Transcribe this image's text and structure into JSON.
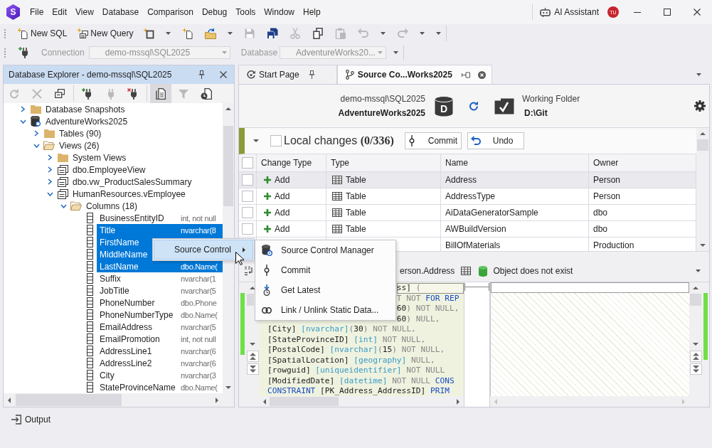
{
  "title_bar": {
    "logo": "S",
    "menu": [
      "File",
      "Edit",
      "View",
      "Database",
      "Comparison",
      "Debug",
      "Tools",
      "Window",
      "Help"
    ],
    "ai_assistant": "AI Assistant",
    "avatar": "TU"
  },
  "toolbar": {
    "buttons": [
      {
        "label": "New SQL"
      },
      {
        "label": "New Query"
      }
    ],
    "tools": [
      {
        "disabled": false,
        "dropdown": true
      },
      {
        "disabled": false,
        "dropdown": false
      },
      {
        "disabled": false,
        "dropdown": true
      },
      {
        "disabled": true,
        "dropdown": false
      },
      {
        "disabled": false,
        "dropdown": false
      },
      {
        "disabled": true,
        "dropdown": false
      },
      {
        "disabled": false,
        "dropdown": false
      },
      {
        "disabled": true,
        "dropdown": false
      },
      {
        "disabled": true,
        "dropdown": true
      },
      {
        "disabled": true,
        "dropdown": true
      }
    ]
  },
  "connection_bar": {
    "fields": [
      {
        "label": "Connection",
        "value": "demo-mssql\\SQL2025",
        "disabled": true
      },
      {
        "label": "Database",
        "value": "AdventureWorks20...",
        "disabled": true
      }
    ]
  },
  "explorer": {
    "title": "Database Explorer - demo-mssql\\SQL2025",
    "tools": [
      {
        "disabled": true,
        "selected": false
      },
      {
        "disabled": true,
        "selected": false
      },
      {
        "disabled": false,
        "selected": false
      },
      {
        "disabled": false,
        "selected": false
      },
      {
        "disabled": true,
        "selected": false
      },
      {
        "disabled": false,
        "selected": false
      },
      {
        "disabled": false,
        "selected": true
      },
      {
        "disabled": true,
        "selected": false
      },
      {
        "disabled": false,
        "selected": false
      }
    ],
    "tree": [
      {
        "label": "Database Snapshots",
        "kind": "folder",
        "expanded": false,
        "selected": false
      },
      {
        "label": "AdventureWorks2025",
        "kind": "database",
        "expanded": true,
        "selected": false,
        "children": [
          {
            "label": "Tables (90)",
            "kind": "folder",
            "expanded": false,
            "selected": false
          },
          {
            "label": "Views (26)",
            "kind": "folder",
            "expanded": true,
            "selected": false,
            "children": [
              {
                "label": "System Views",
                "kind": "folder",
                "expanded": false,
                "selected": false
              },
              {
                "label": "dbo.EmployeeView",
                "kind": "view",
                "expanded": false,
                "selected": false
              },
              {
                "label": "dbo.vw_ProductSalesSummary",
                "kind": "view",
                "expanded": false,
                "selected": false
              },
              {
                "label": "HumanResources.vEmployee",
                "kind": "view",
                "expanded": true,
                "selected": false,
                "children": [
                  {
                    "label": "Columns (18)",
                    "kind": "folder",
                    "expanded": true,
                    "selected": false,
                    "children": [
                      {
                        "label": "BusinessEntityID",
                        "kind": "column",
                        "detail": "int, not null",
                        "selected": false
                      },
                      {
                        "label": "Title",
                        "kind": "column",
                        "detail": "nvarchar(8",
                        "selected": true
                      },
                      {
                        "label": "FirstName",
                        "kind": "column",
                        "selected": true
                      },
                      {
                        "label": "MiddleName",
                        "kind": "column",
                        "selected": true
                      },
                      {
                        "label": "LastName",
                        "kind": "column",
                        "detail": "dbo.Name(",
                        "selected": true
                      },
                      {
                        "label": "Suffix",
                        "kind": "column",
                        "detail": "nvarchar(1",
                        "selected": false
                      },
                      {
                        "label": "JobTitle",
                        "kind": "column",
                        "detail": "nvarchar(5",
                        "selected": false
                      },
                      {
                        "label": "PhoneNumber",
                        "kind": "column",
                        "detail": "dbo.Phone",
                        "selected": false
                      },
                      {
                        "label": "PhoneNumberType",
                        "kind": "column",
                        "detail": "dbo.Name(",
                        "selected": false
                      },
                      {
                        "label": "EmailAddress",
                        "kind": "column",
                        "detail": "nvarchar(5",
                        "selected": false
                      },
                      {
                        "label": "EmailPromotion",
                        "kind": "column",
                        "detail": "int, not null",
                        "selected": false
                      },
                      {
                        "label": "AddressLine1",
                        "kind": "column",
                        "detail": "nvarchar(6",
                        "selected": false
                      },
                      {
                        "label": "AddressLine2",
                        "kind": "column",
                        "detail": "nvarchar(6",
                        "selected": false
                      },
                      {
                        "label": "City",
                        "kind": "column",
                        "detail": "nvarchar(3",
                        "selected": false
                      },
                      {
                        "label": "StateProvinceName",
                        "kind": "column",
                        "detail": "dbo.Name(",
                        "selected": false
                      }
                    ]
                  }
                ]
              }
            ]
          }
        ]
      }
    ]
  },
  "tabs": [
    {
      "label": "Start Page",
      "selected": false,
      "pinned": true
    },
    {
      "label": "Source Co...Works2025",
      "selected": true,
      "pinned": false
    }
  ],
  "source_control": {
    "server": "demo-mssql\\SQL2025",
    "database": "AdventureWorks2025",
    "database_badge": "D",
    "folder_label": "Working Folder",
    "folder": "D:\\Git",
    "local_changes": {
      "expanded": true,
      "checked": false,
      "title": "Local changes **(0/336)**",
      "buttons": [
        {
          "label": "Commit"
        },
        {
          "label": "Undo"
        }
      ]
    },
    "table": {
      "all_checked": false,
      "columns": [
        "Change Type",
        "Type",
        "Name",
        "Owner"
      ],
      "rows": [
        {
          "checked": false,
          "selected": true,
          "change_type": "Add",
          "type": "Table",
          "name": "Address",
          "owner": "Person"
        },
        {
          "checked": false,
          "selected": false,
          "change_type": "Add",
          "type": "Table",
          "name": "AddressType",
          "owner": "Person"
        },
        {
          "checked": false,
          "selected": false,
          "change_type": "Add",
          "type": "Table",
          "name": "AiDataGeneratorSample",
          "owner": "dbo"
        },
        {
          "checked": false,
          "selected": false,
          "change_type": "Add",
          "type": "Table",
          "name": "AWBuildVersion",
          "owner": "dbo"
        },
        {
          "selected": false,
          "name": "BillOfMaterials",
          "owner": "Production"
        }
      ]
    },
    "compare": {
      "object": "erson.Address",
      "status": "Object does not exist",
      "lines": [
        {
          "covered": true,
          "highlighted": true,
          "tokens": [
            {
              "kind": "ident",
              "text": "ss]"
            },
            {
              "kind": "punct",
              "text": " ("
            }
          ]
        },
        {
          "covered": true,
          "highlighted": false,
          "tokens": [
            {
              "kind": "null",
              "text": "T NOT "
            },
            {
              "kind": "keyword",
              "text": "FOR REP"
            }
          ]
        },
        {
          "covered": true,
          "highlighted": false,
          "tokens": [
            {
              "kind": "number",
              "text": "60"
            },
            {
              "kind": "punct",
              "text": ")"
            },
            {
              "kind": "null",
              "text": " NOT NULL,"
            }
          ]
        },
        {
          "covered": true,
          "highlighted": false,
          "tokens": [
            {
              "kind": "number",
              "text": "60"
            },
            {
              "kind": "punct",
              "text": ")"
            },
            {
              "kind": "null",
              "text": " NULL,"
            }
          ]
        },
        {
          "covered": false,
          "highlighted": false,
          "tokens": [
            {
              "kind": "ident",
              "text": "[City]"
            },
            {
              "kind": "type",
              "text": " [nvarchar]"
            },
            {
              "kind": "punct",
              "text": "("
            },
            {
              "kind": "number",
              "text": "30"
            },
            {
              "kind": "punct",
              "text": ")"
            },
            {
              "kind": "null",
              "text": " NOT NULL,"
            }
          ]
        },
        {
          "covered": false,
          "highlighted": false,
          "tokens": [
            {
              "kind": "ident",
              "text": "[StateProvinceID]"
            },
            {
              "kind": "type",
              "text": " [int]"
            },
            {
              "kind": "null",
              "text": " NOT NULL,"
            }
          ]
        },
        {
          "covered": false,
          "highlighted": false,
          "tokens": [
            {
              "kind": "ident",
              "text": "[PostalCode]"
            },
            {
              "kind": "type",
              "text": " [nvarchar]"
            },
            {
              "kind": "punct",
              "text": "("
            },
            {
              "kind": "number",
              "text": "15"
            },
            {
              "kind": "punct",
              "text": ")"
            },
            {
              "kind": "null",
              "text": " NOT NULL,"
            }
          ]
        },
        {
          "covered": false,
          "highlighted": false,
          "tokens": [
            {
              "kind": "ident",
              "text": "[SpatialLocation]"
            },
            {
              "kind": "type",
              "text": " [geography]"
            },
            {
              "kind": "null",
              "text": " NULL,"
            }
          ]
        },
        {
          "covered": false,
          "highlighted": false,
          "tokens": [
            {
              "kind": "ident",
              "text": "[rowguid]"
            },
            {
              "kind": "type",
              "text": " [uniqueidentifier]"
            },
            {
              "kind": "null",
              "text": " NOT NULL"
            }
          ]
        },
        {
          "covered": false,
          "highlighted": false,
          "tokens": [
            {
              "kind": "ident",
              "text": "[ModifiedDate]"
            },
            {
              "kind": "type",
              "text": " [datetime]"
            },
            {
              "kind": "null",
              "text": " NOT NULL"
            },
            {
              "kind": "keyword",
              "text": " CONS"
            }
          ]
        },
        {
          "covered": false,
          "highlighted": false,
          "tokens": [
            {
              "kind": "keyword",
              "text": "CONSTRAINT"
            },
            {
              "kind": "ident",
              "text": " [PK_Address_AddressID]"
            },
            {
              "kind": "keyword",
              "text": " PRIM"
            }
          ]
        }
      ]
    }
  },
  "context_menu": {
    "items": [
      {
        "label": "Source Control",
        "selected": true,
        "children": [
          {
            "label": "Source Control Manager"
          },
          {
            "label": "Commit"
          },
          {
            "label": "Get Latest"
          },
          {
            "label": "Link / Unlink Static Data..."
          }
        ]
      }
    ]
  },
  "output": {
    "label": "Output"
  }
}
